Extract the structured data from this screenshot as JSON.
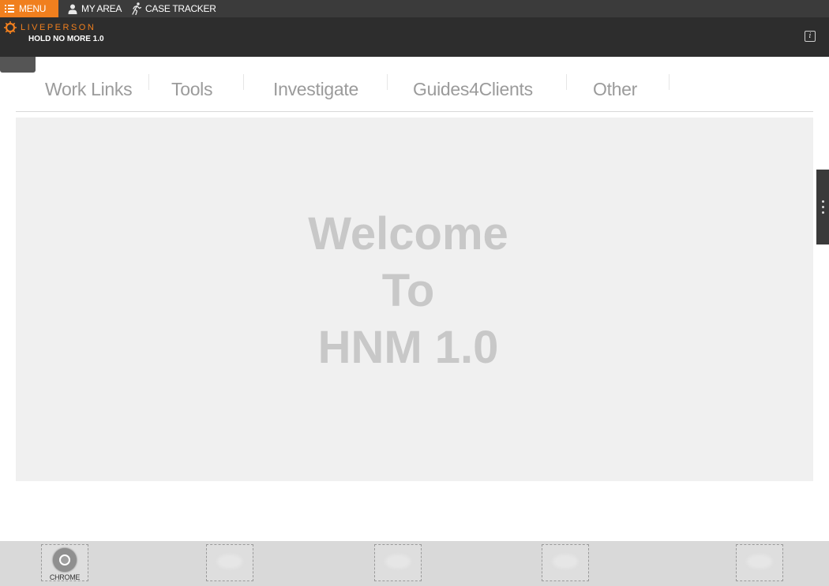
{
  "topbar": {
    "menu_label": "MENU",
    "my_area_label": "MY AREA",
    "case_tracker_label": "CASE TRACKER"
  },
  "header": {
    "logo_text": "LIVEPERSON",
    "app_title": "HOLD NO MORE 1.0",
    "info_label": "i"
  },
  "nav": {
    "items": [
      {
        "label": "Work Links"
      },
      {
        "label": "Tools"
      },
      {
        "label": "Investigate"
      },
      {
        "label": "Guides4Clients"
      },
      {
        "label": "Other"
      }
    ]
  },
  "welcome": {
    "line1": "Welcome",
    "line2": "To",
    "line3": "HNM 1.0"
  },
  "dock": {
    "slots": [
      {
        "label": "CHROME",
        "icon": "chrome-icon"
      },
      {
        "label": ""
      },
      {
        "label": ""
      },
      {
        "label": ""
      },
      {
        "label": ""
      }
    ]
  },
  "colors": {
    "accent": "#f07f1e",
    "header_bg": "#2d2d2d",
    "topbar_bg": "#3b3b3b",
    "panel_bg": "#f0f0f0",
    "welcome_text": "#c8c8c8"
  }
}
